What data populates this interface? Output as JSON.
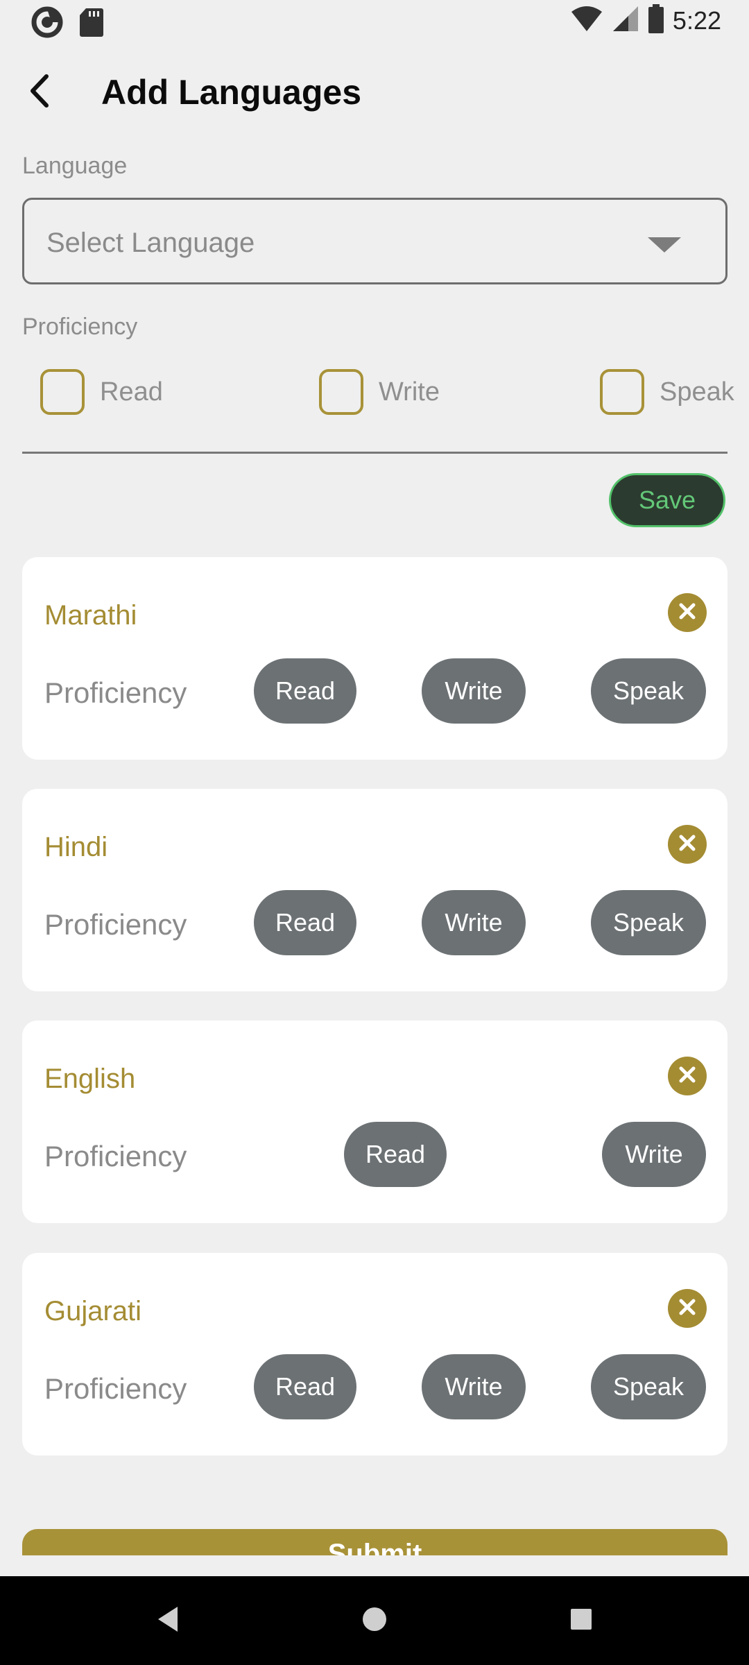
{
  "status_bar": {
    "time": "5:22",
    "icons": [
      "sync-app-icon",
      "sd-card-icon",
      "wifi-icon",
      "signal-icon",
      "battery-icon"
    ]
  },
  "header": {
    "title": "Add Languages",
    "back_icon": "back-arrow-icon"
  },
  "form": {
    "language_label": "Language",
    "select_placeholder": "Select Language",
    "proficiency_label": "Proficiency",
    "options": [
      {
        "label": "Read",
        "checked": false
      },
      {
        "label": "Write",
        "checked": false
      },
      {
        "label": "Speak",
        "checked": false
      }
    ],
    "save_label": "Save"
  },
  "languages": [
    {
      "name": "Marathi",
      "proficiency_label": "Proficiency",
      "skills": [
        "Read",
        "Write",
        "Speak"
      ]
    },
    {
      "name": "Hindi",
      "proficiency_label": "Proficiency",
      "skills": [
        "Read",
        "Write",
        "Speak"
      ]
    },
    {
      "name": "English",
      "proficiency_label": "Proficiency",
      "skills": [
        "Read",
        "Write"
      ]
    },
    {
      "name": "Gujarati",
      "proficiency_label": "Proficiency",
      "skills": [
        "Read",
        "Write",
        "Speak"
      ]
    }
  ],
  "submit": {
    "label": "Submit"
  },
  "colors": {
    "accent": "#a89238",
    "pill": "#6c7174",
    "save_bg": "#2c3b2f",
    "save_text": "#63c878"
  }
}
